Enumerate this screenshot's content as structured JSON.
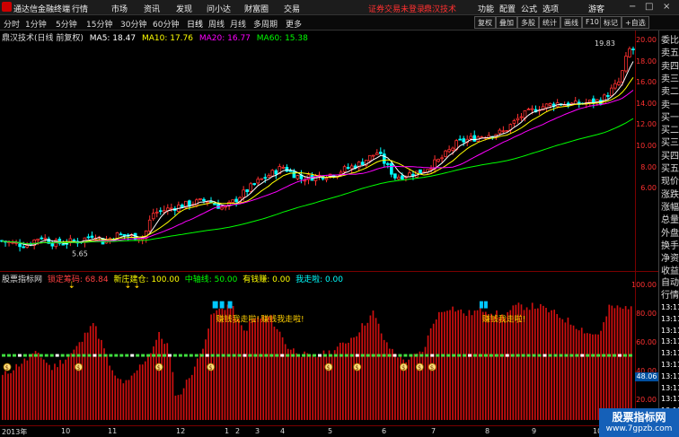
{
  "titlebar": {
    "app_name": "通达信金融终端",
    "menu": [
      "行情",
      "市场",
      "资讯",
      "发现",
      "问小达",
      "财富圈",
      "交易"
    ],
    "notice": "证券交易未登录",
    "stock_name": "鼎汉技术",
    "right_menu": [
      "功能",
      "配置",
      "公式",
      "选项"
    ],
    "user": "游客",
    "window_buttons": [
      "−",
      "□",
      "×"
    ]
  },
  "periods": [
    "分时",
    "1分钟",
    "5分钟",
    "15分钟",
    "30分钟",
    "60分钟",
    "日线",
    "周线",
    "月线",
    "多周期",
    "更多"
  ],
  "active_period": "日线",
  "tools": [
    "复权",
    "叠加",
    "多股",
    "统计",
    "画线",
    "F10",
    "标记",
    "+自选"
  ],
  "main": {
    "title": "鼎汉技术(日线 前复权)",
    "ma": [
      {
        "label": "MA5: 18.47",
        "color": "#ffffff"
      },
      {
        "label": "MA10: 17.76",
        "color": "#ffff00"
      },
      {
        "label": "MA20: 16.77",
        "color": "#ff00ff"
      },
      {
        "label": "MA60: 15.38",
        "color": "#00ff00"
      }
    ],
    "high_label": "19.83",
    "low_label": "5.65",
    "yticks": [
      "20.00",
      "18.00",
      "16.00",
      "14.00",
      "12.00",
      "10.00",
      "8.00",
      "6.00"
    ]
  },
  "sub": {
    "name": "股票指标网",
    "items": [
      {
        "label": "锁定筹码: 68.84",
        "color": "#ff4040"
      },
      {
        "label": "新庄建仓: 100.00",
        "color": "#ffff00"
      },
      {
        "label": "中轴线: 50.00",
        "color": "#00ff00"
      },
      {
        "label": "有钱赚: 0.00",
        "color": "#ffff00"
      },
      {
        "label": "我走啦: 0.00",
        "color": "#00ffff"
      }
    ],
    "yticks": [
      "100.00",
      "80.00",
      "60.00",
      "40.00",
      "20.00"
    ],
    "current_value": "48.06",
    "annotations": [
      "赚钱我走啦!",
      "赚钱我走啦!",
      "赚钱我走啦!"
    ]
  },
  "dates": [
    "2013年",
    "10",
    "11",
    "12",
    "1",
    "2",
    "3",
    "4",
    "5",
    "6",
    "7",
    "8",
    "9",
    "10"
  ],
  "sidebar": [
    "委比",
    "卖五",
    "卖四",
    "卖三",
    "卖二",
    "卖一",
    "买一",
    "买二",
    "买三",
    "买四",
    "买五",
    "现价",
    "涨跌",
    "涨幅",
    "总量",
    "外盘",
    "换手",
    "净资",
    "收益",
    "自动",
    "行情",
    "13:11",
    "13:11",
    "13:11",
    "13:11",
    "13:11",
    "13:11",
    "13:11",
    "13:11",
    "13:11",
    "13:11",
    "13:11"
  ],
  "watermark": {
    "title": "股票指标网",
    "url": "www.7gpzb.com"
  }
}
